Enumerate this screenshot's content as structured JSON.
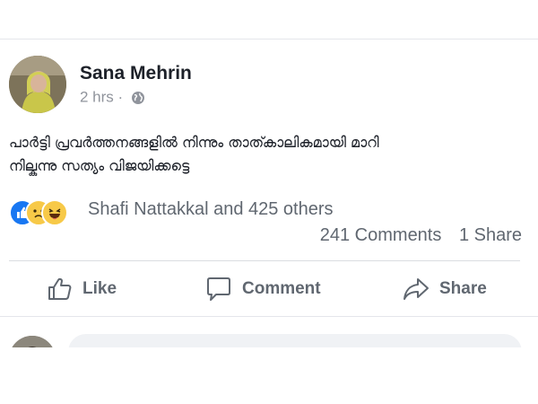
{
  "post": {
    "author": "Sana Mehrin",
    "time": "2 hrs",
    "separator": "·",
    "privacy_icon": "globe-icon",
    "text_line1": "പാർട്ടി പ്രവർത്തനങ്ങളിൽ നിന്നും താത്കാലികമായി മാറി",
    "text_line2": "നില്കുന്നു സത്യം വിജയിക്കട്ടെ"
  },
  "reactions": {
    "icons": [
      "like-icon",
      "sad-icon",
      "haha-icon"
    ],
    "summary": "Shafi Nattakkal and 425 others",
    "comments": "241 Comments",
    "shares": "1 Share"
  },
  "actions": {
    "like_label": "Like",
    "comment_label": "Comment",
    "share_label": "Share"
  },
  "colors": {
    "like_blue": "#1877f2",
    "emoji_yellow": "#f7c948",
    "secondary_text": "#606770"
  }
}
